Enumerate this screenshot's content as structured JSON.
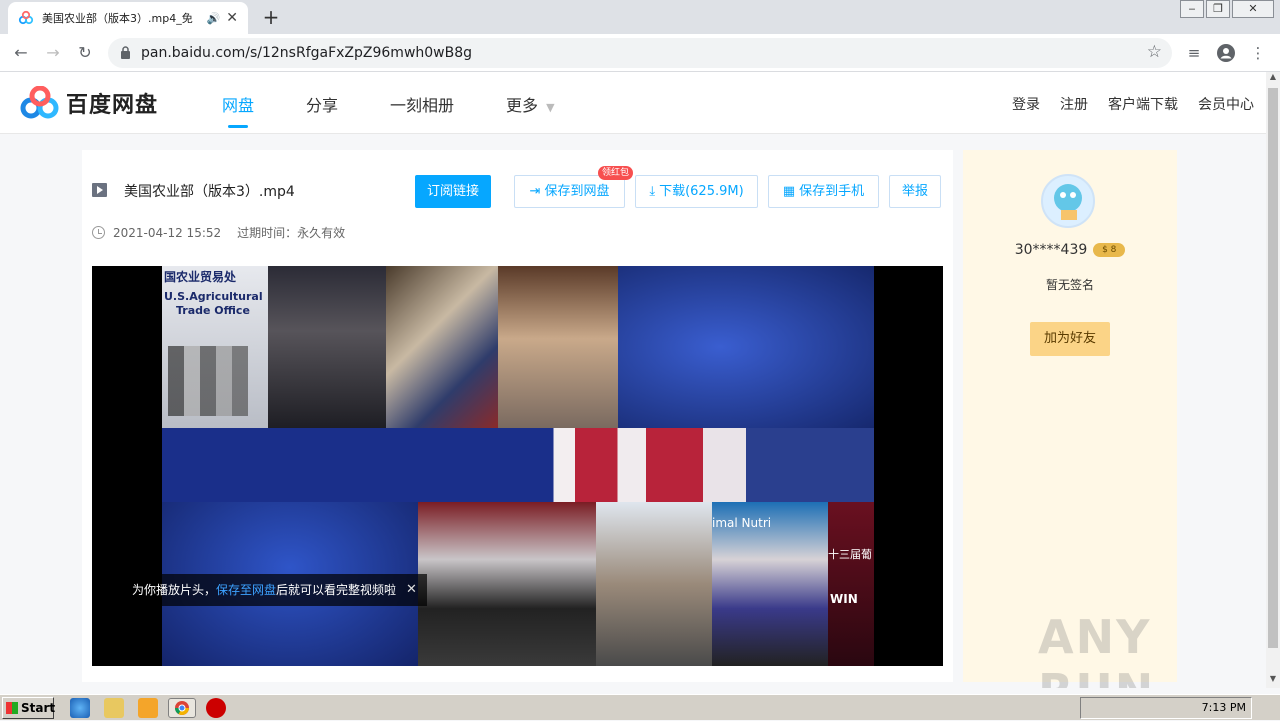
{
  "browser": {
    "tab_title": "美国农业部（版本3）.mp4_免",
    "url": "pan.baidu.com/s/12nsRfgaFxZpZ96mwh0wB8g"
  },
  "site": {
    "logo_text": "百度网盘",
    "nav": [
      {
        "label": "网盘",
        "active": true
      },
      {
        "label": "分享"
      },
      {
        "label": "一刻相册"
      },
      {
        "label": "更多"
      }
    ],
    "top_links": [
      "登录",
      "注册",
      "客户端下载",
      "会员中心"
    ]
  },
  "file": {
    "name": "美国农业部（版本3）.mp4",
    "date": "2021-04-12 15:52",
    "expiry": "过期时间：永久有效",
    "buttons": {
      "subscribe": "订阅链接",
      "save_to_disk": "保存到网盘",
      "red_packet": "领红包",
      "download": "下载(625.9M)",
      "save_to_phone": "保存到手机",
      "report": "举报"
    }
  },
  "video": {
    "toast_prefix": "为你播放片头，",
    "toast_link": "保存至网盘",
    "toast_suffix": " 后就可以看完整视频啦",
    "overlay_texts": [
      "国农业贸易处",
      "U.S.Agricultural",
      "Trade Office",
      "imal Nutri",
      "十三届葡",
      "WIN"
    ]
  },
  "user": {
    "name": "30****439",
    "vip_badge": "$ 8",
    "signature": "暂无签名",
    "add_friend": "加为好友"
  },
  "watermark": "ANY RUN",
  "taskbar": {
    "start": "Start",
    "clock": "7:13 PM"
  }
}
